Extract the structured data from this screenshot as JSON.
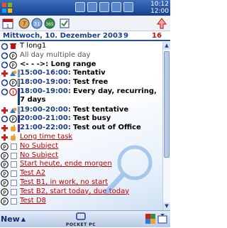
{
  "status": {
    "time": "10:12",
    "alarm": "12:00"
  },
  "header": {
    "date": "Mittwoch, 10. Dezember 2003",
    "week": "9",
    "tasks": "16"
  },
  "events": [
    {
      "kind": "allday",
      "text": "T long1",
      "icons": [
        "recur-icon",
        "phone-icon"
      ]
    },
    {
      "kind": "allday",
      "text": "All day multiple day",
      "icons": [
        "recur-icon",
        "private-icon"
      ],
      "muted": true
    },
    {
      "kind": "range",
      "text": "<- - ->: Long range",
      "icons": [
        "recur-icon",
        "private-icon"
      ]
    },
    {
      "kind": "appt",
      "time": "15:00-16:00:",
      "title": "Tentativ",
      "icons": [
        "plus-icon",
        "tentative-icon"
      ],
      "bar": "#7f8fb0"
    },
    {
      "kind": "appt",
      "time": "18:00-19:00:",
      "title": "Test free",
      "icons": [
        "recur-icon",
        "private-icon"
      ],
      "bar": "#ffffff"
    },
    {
      "kind": "appt2",
      "time": "18:00-19:00:",
      "title": "Every day, recurring, 7 days",
      "icons": [
        "recur-icon",
        "important-icon"
      ],
      "bar": "#1b3b86"
    },
    {
      "kind": "appt",
      "time": "19:00-20:00:",
      "title": "Test tentative",
      "icons": [
        "plus-icon",
        "tentative-icon"
      ],
      "bar": "#7f8fb0"
    },
    {
      "kind": "appt",
      "time": "20:00-21:00:",
      "title": "Test busy",
      "icons": [
        "recur-icon",
        "private-icon"
      ],
      "bar": "#1b3b86"
    },
    {
      "kind": "appt",
      "time": "21:00-22:00:",
      "title": "Test out of Office",
      "icons": [
        "plus-icon",
        "hand-icon"
      ],
      "bar": "#7a2a9a"
    }
  ],
  "tasks": [
    {
      "text": "Long time task",
      "icons": [
        "plus-icon",
        "hand-icon"
      ]
    },
    {
      "text": "No Subject",
      "icons": [
        "private-icon"
      ]
    },
    {
      "text": "No Subject",
      "icons": [
        "private-icon"
      ]
    },
    {
      "text": "Start heute, ende morgen",
      "icons": [
        "private-icon"
      ]
    },
    {
      "text": "Test A2",
      "icons": [
        "private-icon"
      ]
    },
    {
      "text": "Test B1, in work, no start",
      "icons": [
        "private-icon"
      ]
    },
    {
      "text": "Test B2, start today, due today",
      "icons": [
        "private-icon"
      ]
    },
    {
      "text": "Test D8",
      "icons": [
        "private-icon"
      ]
    }
  ],
  "bottom": {
    "new_label": "New",
    "logo_text": "POCKET PC"
  },
  "colors": {
    "accent": "#1a3f8f",
    "task": "#c20000",
    "titlebar": "#2450a0"
  }
}
